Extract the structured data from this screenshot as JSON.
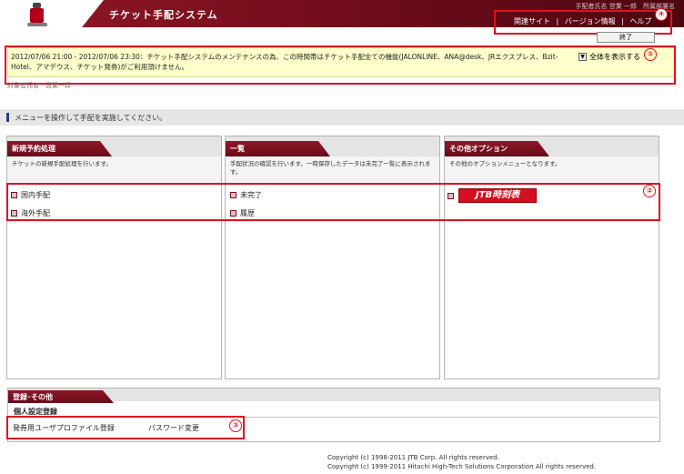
{
  "header": {
    "title": "チケット手配システム",
    "user_info": "手配者氏名 営業 一郎　所属部署名",
    "links": [
      "関連サイト",
      "バージョン情報",
      "ヘルプ"
    ],
    "link_separator": "|",
    "end_label": "終了"
  },
  "notice": {
    "text": "2012/07/06 21:00 - 2012/07/06 23:30：チケット手配システムのメンテナンスの為、この時間帯はチケット手配全ての機能(JALONLINE、ANA@desk、JRエクスプレス、Bzit-Hotel、アマデウス、チケット発券)がご利用頂けません。",
    "show_all_label": "全体を表示する"
  },
  "target_label": "対象者氏名　営業一郎",
  "instruction": "メニューを操作して手配を実施してください。",
  "panels": [
    {
      "title": "新規予約処理",
      "description": "チケットの新規手配処理を行います。",
      "items": [
        "国内手配",
        "海外手配"
      ]
    },
    {
      "title": "一覧",
      "description": "手配状況の確認を行います。一時保存したデータは未完了一覧に表示されます。",
      "items": [
        "未完了",
        "履歴"
      ]
    },
    {
      "title": "その他オプション",
      "description": "その他のオプションメニューとなります。",
      "button_label": "JTB時刻表"
    }
  ],
  "registration": {
    "title": "登録･その他",
    "subtitle": "個人設定登録",
    "links": [
      "発券用ユーザプロファイル登録",
      "パスワード変更"
    ]
  },
  "badges": [
    "①",
    "②",
    "③",
    "④"
  ],
  "copyright": [
    "Copyright (c) 1998-2011 JTB Corp. All rights reserved.",
    "Copyright (c) 1999-2011 Hitachi High-Tech Solutions Corporation All rights reserved."
  ],
  "colors": {
    "brand": "#6a0b19",
    "annotation": "#e01020",
    "notice_bg": "#ffffcc",
    "jtb_red": "#d40f1f"
  }
}
